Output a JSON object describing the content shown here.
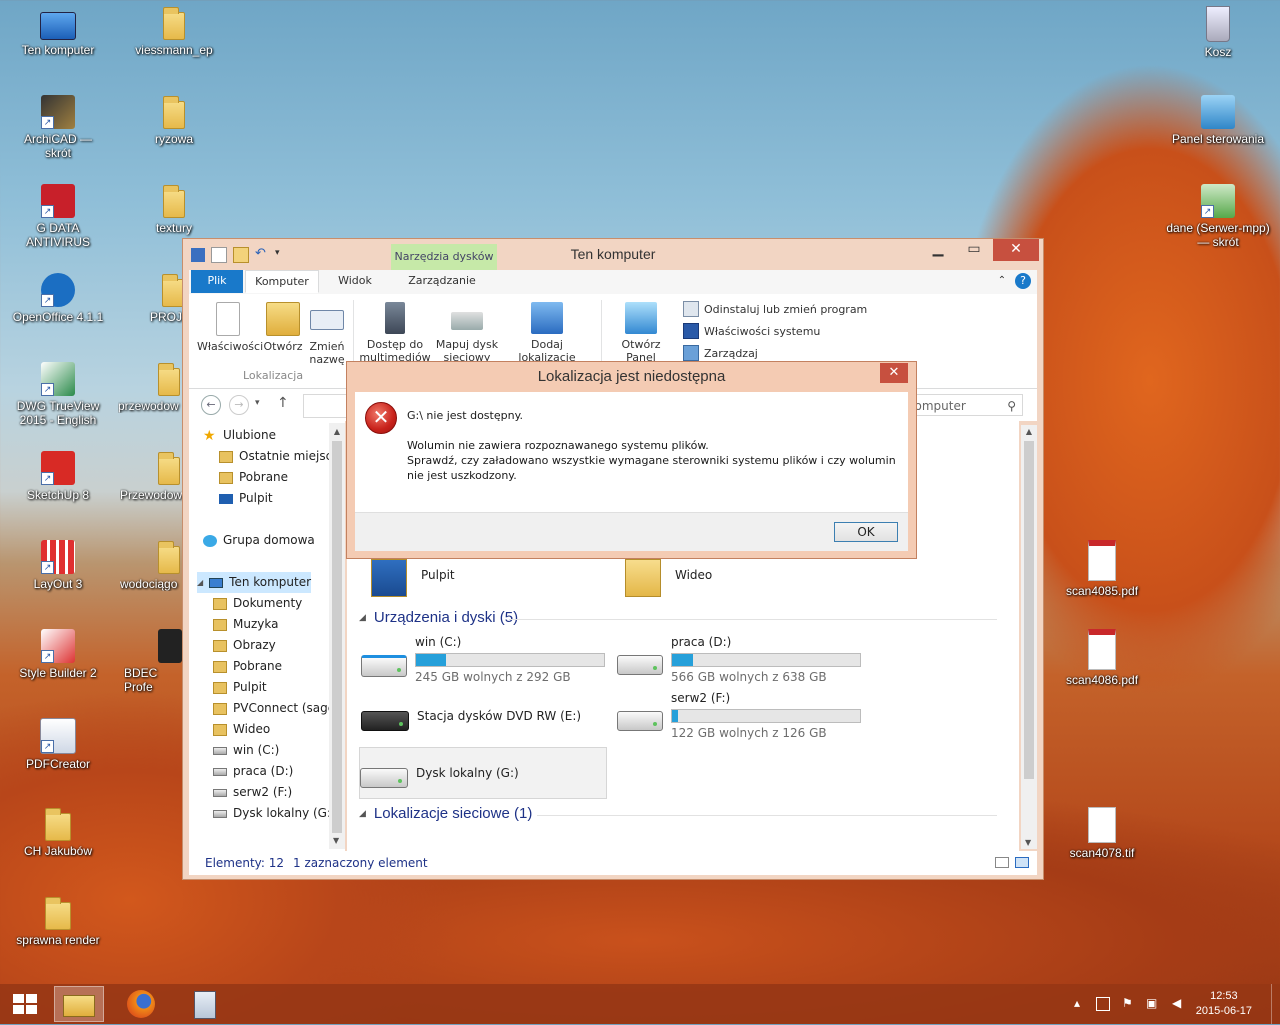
{
  "desktop": {
    "icons_left": [
      {
        "label": "Ten komputer",
        "icon": "computer-icon"
      },
      {
        "label": "ArchiCAD — skrót",
        "icon": "archicad-icon"
      },
      {
        "label": "G DATA ANTIVIRUS",
        "icon": "gdata-icon"
      },
      {
        "label": "OpenOffice 4.1.1",
        "icon": "openoffice-icon"
      },
      {
        "label": "DWG TrueView 2015 - English",
        "icon": "dwg-icon"
      },
      {
        "label": "SketchUp 8",
        "icon": "sketchup-icon"
      },
      {
        "label": "LayOut 3",
        "icon": "layout-icon"
      },
      {
        "label": "Style Builder 2",
        "icon": "stylebuilder-icon"
      },
      {
        "label": "PDFCreator",
        "icon": "pdfcreator-icon"
      },
      {
        "label": "CH Jakubów",
        "icon": "folder-icon"
      },
      {
        "label": "sprawna render",
        "icon": "folder-icon"
      }
    ],
    "icons_col2": [
      {
        "label": "viessmann_ep"
      },
      {
        "label": "ryzowa"
      },
      {
        "label": "textury"
      },
      {
        "label": "PROJE"
      },
      {
        "label": "przewodow"
      },
      {
        "label": "Przewodow"
      },
      {
        "label": "wodociągo"
      },
      {
        "label": "BDEC Profe"
      }
    ],
    "icons_right": [
      {
        "label": "Kosz",
        "icon": "recycle-bin-icon"
      },
      {
        "label": "Panel sterowania",
        "icon": "control-panel-icon"
      },
      {
        "label": "dane (Serwer-mpp) — skrót",
        "icon": "network-drive-icon"
      },
      {
        "label": "scan4085.pdf",
        "icon": "pdf-icon"
      },
      {
        "label": "scan4086.pdf",
        "icon": "pdf-icon"
      },
      {
        "label": "scan4078.tif",
        "icon": "image-file-icon"
      }
    ]
  },
  "explorer": {
    "title": "Ten komputer",
    "context_tab": "Narzędzia dysków",
    "tabs": [
      "Plik",
      "Komputer",
      "Widok",
      "Zarządzanie"
    ],
    "ribbon": {
      "location_group": "Lokalizacja",
      "buttons": [
        {
          "label": "Właściwości"
        },
        {
          "label": "Otwórz"
        },
        {
          "label": "Zmień nazwę"
        },
        {
          "label": "Dostęp do multimediów"
        },
        {
          "label": "Mapuj dysk sieciowy"
        },
        {
          "label": "Dodaj lokalizację sieciową"
        },
        {
          "label": "Otwórz Panel sterowania"
        }
      ],
      "small": [
        "Odinstaluj lub zmień program",
        "Właściwości systemu",
        "Zarządzaj"
      ]
    },
    "search_placeholder": "komputer",
    "nav": [
      {
        "label": "Ulubione",
        "icon": "star"
      },
      {
        "label": "Ostatnie miejsca",
        "icon": "fold"
      },
      {
        "label": "Pobrane",
        "icon": "fold"
      },
      {
        "label": "Pulpit",
        "icon": "desk"
      },
      {
        "label": "Grupa domowa",
        "icon": "home"
      },
      {
        "label": "Ten komputer",
        "icon": "pc"
      },
      {
        "label": "Dokumenty",
        "icon": "fold"
      },
      {
        "label": "Muzyka",
        "icon": "fold"
      },
      {
        "label": "Obrazy",
        "icon": "fold"
      },
      {
        "label": "Pobrane",
        "icon": "fold"
      },
      {
        "label": "Pulpit",
        "icon": "fold"
      },
      {
        "label": "PVConnect (sage",
        "icon": "fold"
      },
      {
        "label": "Wideo",
        "icon": "fold"
      },
      {
        "label": "win (C:)",
        "icon": "drive"
      },
      {
        "label": "praca (D:)",
        "icon": "drive"
      },
      {
        "label": "serw2 (F:)",
        "icon": "drive"
      },
      {
        "label": "Dysk lokalny (G:)",
        "icon": "drive"
      }
    ],
    "folders": [
      {
        "label": "Pulpit"
      },
      {
        "label": "Wideo"
      }
    ],
    "devices_header": "Urządzenia i dyski (5)",
    "drives": [
      {
        "name": "win (C:)",
        "free": "245 GB wolnych z 292 GB",
        "used_fraction": 0.16
      },
      {
        "name": "praca (D:)",
        "free": "566 GB wolnych z 638 GB",
        "used_fraction": 0.11
      },
      {
        "name": "Stacja dysków DVD RW (E:)"
      },
      {
        "name": "serw2 (F:)",
        "free": "122 GB wolnych z 126 GB",
        "used_fraction": 0.03
      },
      {
        "name": "Dysk lokalny (G:)"
      }
    ],
    "network_header": "Lokalizacje sieciowe (1)",
    "status": {
      "items": "Elementy: 12",
      "selected": "1 zaznaczony element"
    }
  },
  "dialog": {
    "title": "Lokalizacja jest niedostępna",
    "line1": "G:\\ nie jest dostępny.",
    "line2": "Wolumin nie zawiera rozpoznawanego systemu plików.",
    "line3": "Sprawdź, czy załadowano wszystkie wymagane sterowniki systemu plików i czy wolumin nie jest uszkodzony.",
    "ok": "OK"
  },
  "taskbar": {
    "time": "12:53",
    "date": "2015-06-17"
  }
}
